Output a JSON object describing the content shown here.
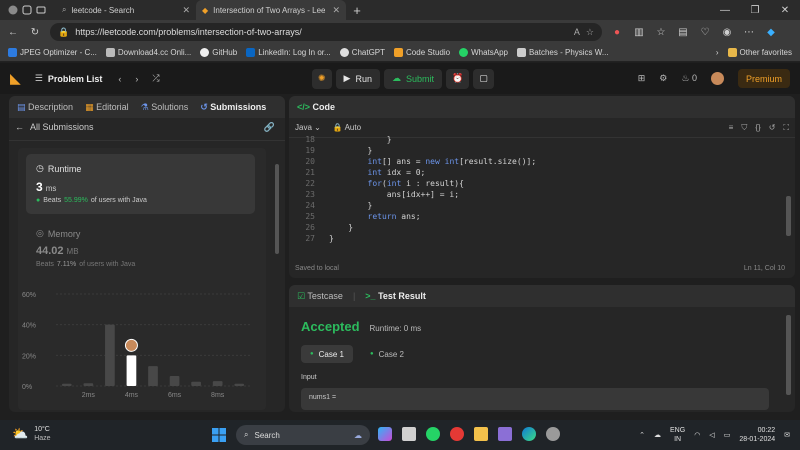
{
  "browser": {
    "tabs": [
      {
        "title": "leetcode - Search",
        "active": false
      },
      {
        "title": "Intersection of Two Arrays - Leet",
        "active": true
      }
    ],
    "url": "https://leetcode.com/problems/intersection-of-two-arrays/",
    "bookmarks": [
      {
        "label": "JPEG Optimizer - C...",
        "color": "#2d7be0"
      },
      {
        "label": "Download4.cc Onli...",
        "color": "#bbbbbb"
      },
      {
        "label": "GitHub",
        "color": "#eeeeee"
      },
      {
        "label": "LinkedIn: Log In or...",
        "color": "#0a66c2"
      },
      {
        "label": "ChatGPT",
        "color": "#dddddd"
      },
      {
        "label": "Code Studio",
        "color": "#f0a028"
      },
      {
        "label": "WhatsApp",
        "color": "#25d366"
      },
      {
        "label": "Batches - Physics W...",
        "color": "#cccccc"
      }
    ],
    "other_favorites": "Other favorites"
  },
  "lc": {
    "problem_list": "Problem List",
    "run": "Run",
    "submit": "Submit",
    "streak": "0",
    "premium": "Premium"
  },
  "left": {
    "tabs": [
      "Description",
      "Editorial",
      "Solutions",
      "Submissions"
    ],
    "back": "All Submissions",
    "runtime_label": "Runtime",
    "runtime_value": "3",
    "runtime_unit": "ms",
    "runtime_beats_prefix": "Beats",
    "runtime_beats": "55.99%",
    "runtime_beats_suffix": "of users with Java",
    "memory_label": "Memory",
    "memory_value": "44.02",
    "memory_unit": "MB",
    "memory_beats_prefix": "Beats",
    "memory_beats": "7.11%",
    "memory_beats_suffix": "of users with Java"
  },
  "chart_data": {
    "type": "bar",
    "y_ticks": [
      "60%",
      "40%",
      "20%",
      "0%"
    ],
    "x_ticks": [
      "2ms",
      "4ms",
      "6ms",
      "8ms"
    ],
    "ylim": [
      0,
      60
    ],
    "values": [
      1.5,
      1.8,
      40,
      20,
      13,
      6.5,
      2.8,
      3.2,
      1.5
    ],
    "highlight_index": 3
  },
  "code": {
    "header": "Code",
    "language": "Java",
    "mode": "Auto",
    "lines": [
      {
        "n": "18",
        "t": "            }"
      },
      {
        "n": "19",
        "t": "        }"
      },
      {
        "n": "20",
        "t": "        int[] ans = new int[result.size()];"
      },
      {
        "n": "21",
        "t": "        int idx = 0;"
      },
      {
        "n": "22",
        "t": "        for(int i : result){"
      },
      {
        "n": "23",
        "t": "            ans[idx++] = i;"
      },
      {
        "n": "24",
        "t": "        }"
      },
      {
        "n": "25",
        "t": "        return ans;"
      },
      {
        "n": "26",
        "t": "    }"
      },
      {
        "n": "27",
        "t": "}"
      }
    ],
    "saved": "Saved to local",
    "position": "Ln 11, Col 10"
  },
  "test": {
    "tab_testcase": "Testcase",
    "tab_result": "Test Result",
    "status": "Accepted",
    "runtime": "Runtime: 0 ms",
    "cases": [
      "Case 1",
      "Case 2"
    ],
    "input_label": "Input",
    "input_name": "nums1 ="
  },
  "taskbar": {
    "weather_temp": "10°C",
    "weather_desc": "Haze",
    "search": "Search",
    "lang1": "ENG",
    "lang2": "IN",
    "time": "00:22",
    "date": "28-01-2024"
  }
}
